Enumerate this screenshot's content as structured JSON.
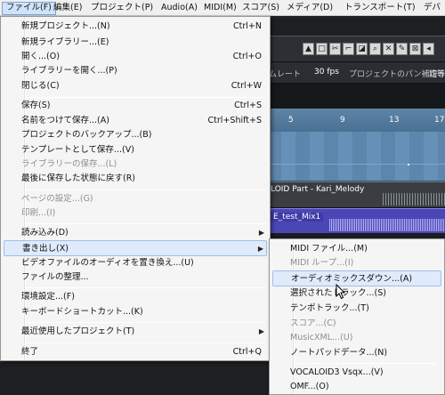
{
  "menubar": {
    "items": [
      "ファイル(F)",
      "編集(E)",
      "プロジェクト(P)",
      "Audio(A)",
      "MIDI(M)",
      "スコア(S)",
      "メディア(D)",
      "トランスポート(T)",
      "デバ"
    ]
  },
  "infobar": {
    "rate": "ムレート",
    "fps": "30 fps",
    "pan": "プロジェクトのパン補正",
    "even": "均等"
  },
  "ruler": {
    "ticks": [
      "5",
      "9",
      "13",
      "17"
    ]
  },
  "tracks": {
    "vocaloid_label": "LOID Part - Kari_Melody",
    "mix_label": "E_test_Mix1"
  },
  "file_menu": {
    "new_project": "新規プロジェクト...(N)",
    "new_project_sc": "Ctrl+N",
    "new_library": "新規ライブラリー...(E)",
    "open": "開く...(O)",
    "open_sc": "Ctrl+O",
    "open_library": "ライブラリーを開く...(P)",
    "close": "閉じる(C)",
    "close_sc": "Ctrl+W",
    "save": "保存(S)",
    "save_sc": "Ctrl+S",
    "save_as": "名前をつけて保存...(A)",
    "save_as_sc": "Ctrl+Shift+S",
    "backup": "プロジェクトのバックアップ...(B)",
    "save_template": "テンプレートとして保存...(V)",
    "save_library": "ライブラリーの保存...(L)",
    "revert": "最後に保存した状態に戻す(R)",
    "page_setup": "ページの設定...(G)",
    "print": "印刷...(I)",
    "import": "読み込み(D)",
    "export": "書き出し(X)",
    "replace_video_audio": "ビデオファイルのオーディオを置き換え...(U)",
    "cleanup": "ファイルの整理...",
    "preferences": "環境設定...(F)",
    "key_commands": "キーボードショートカット...(K)",
    "recent": "最近使用したプロジェクト(T)",
    "quit": "終了",
    "quit_sc": "Ctrl+Q"
  },
  "export_menu": {
    "midi_file": "MIDI ファイル...(M)",
    "midi_loop": "MIDI ループ...(I)",
    "audio_mixdown": "オーディオミックスダウン...(A)",
    "selected_tracks": "選択されたトラック...(S)",
    "tempo_track": "テンポトラック...(T)",
    "score": "スコア...(C)",
    "musicxml": "MusicXML...(U)",
    "notepad": "ノートパッドデータ...(N)",
    "vocaloid3": "VOCALOID3 Vsqx...(V)",
    "omf": "OMF...(O)"
  }
}
